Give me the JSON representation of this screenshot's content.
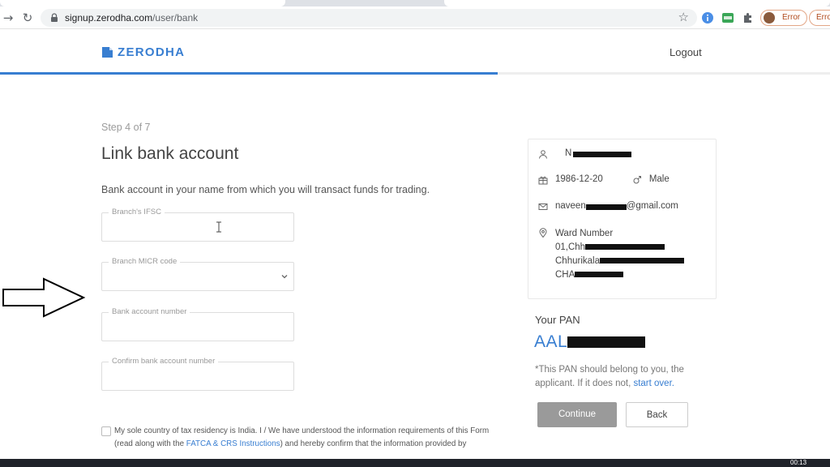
{
  "browser": {
    "url_host": "signup.zerodha.com",
    "url_path": "/user/bank",
    "error_label": "Error",
    "error_label_2": "Erro"
  },
  "header": {
    "brand": "ZERODHA",
    "logout": "Logout",
    "progress": 0.6
  },
  "form": {
    "step": "Step 4 of 7",
    "title": "Link bank account",
    "description": "Bank account in your name from which you will transact funds for trading.",
    "ifsc_label": "Branch's IFSC",
    "micr_label": "Branch MICR code",
    "account_label": "Bank account number",
    "confirm_label": "Confirm bank account number",
    "consent_1": "My sole country of tax residency is India. I / We have understood the information requirements of this Form (read along with the ",
    "consent_link": "FATCA & CRS Instructions",
    "consent_2": ") and hereby confirm that the information provided by"
  },
  "profile": {
    "name_prefix": "N",
    "dob": "1986-12-20",
    "gender": "Male",
    "email_prefix": "naveen",
    "email_suffix": "@gmail.com",
    "address_line1": "Ward Number",
    "address_line2": "01,Chh",
    "address_line3": "Chhurikala",
    "address_line4": "CHA"
  },
  "pan": {
    "label": "Your PAN",
    "value_prefix": "AAL",
    "note": "*This PAN should belong to you, the applicant. If it does not, ",
    "note_link": "start over."
  },
  "actions": {
    "continue": "Continue",
    "back": "Back"
  },
  "taskbar": {
    "clock": "00:13"
  },
  "colors": {
    "brand": "#387ed1",
    "button_disabled": "#9a9a9a"
  }
}
